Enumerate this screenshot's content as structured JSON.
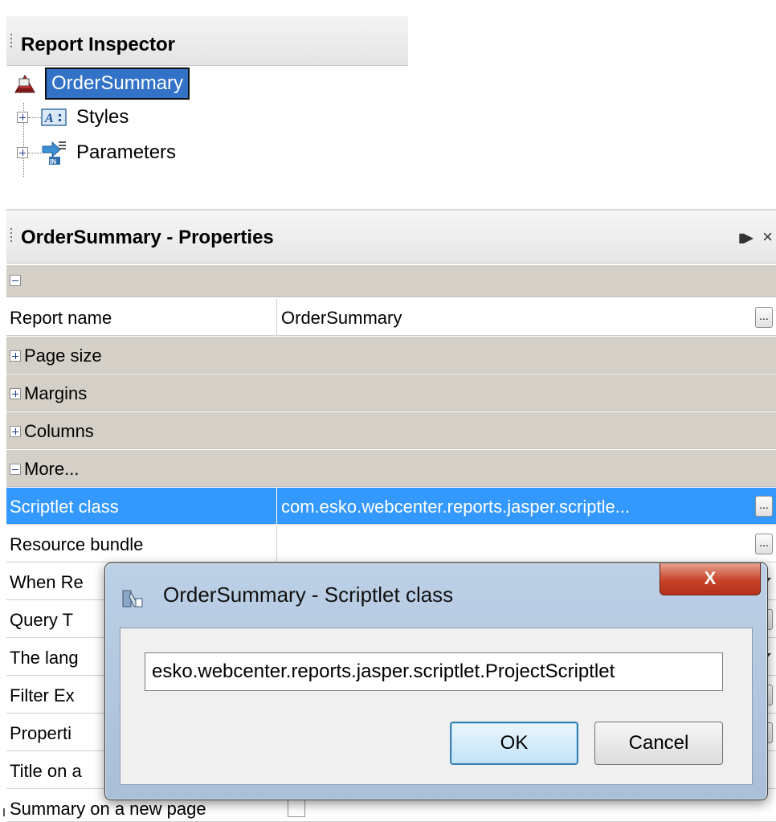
{
  "inspector": {
    "title": "Report Inspector",
    "root": {
      "label": "OrderSummary",
      "icon": "report-icon"
    },
    "nodes": [
      {
        "label": "Styles",
        "icon": "styles-icon"
      },
      {
        "label": "Parameters",
        "icon": "parameters-icon"
      }
    ]
  },
  "properties": {
    "title": "OrderSummary - Properties",
    "rows": {
      "report_name": {
        "name": "Report name",
        "value": "OrderSummary"
      },
      "page_size": {
        "name": "Page size"
      },
      "margins": {
        "name": "Margins"
      },
      "columns": {
        "name": "Columns"
      },
      "more": {
        "name": "More..."
      },
      "scriptlet_class": {
        "name": "Scriptlet class",
        "value": "com.esko.webcenter.reports.jasper.scriptle..."
      },
      "resource_bundle": {
        "name": "Resource bundle",
        "value": ""
      },
      "when_resource": {
        "name": "When Re"
      },
      "query_text": {
        "name": "Query T"
      },
      "language": {
        "name": "The lang"
      },
      "filter_expression": {
        "name": "Filter Ex"
      },
      "properties": {
        "name": "Properti"
      },
      "title_on": {
        "name": "Title on a"
      },
      "summary_new_page": {
        "name": "Summary on a new page"
      }
    },
    "ellipsis_label": "..."
  },
  "dialog": {
    "title": "OrderSummary - Scriptlet class",
    "close_label": "X",
    "input_value": "esko.webcenter.reports.jasper.scriptlet.ProjectScriptlet",
    "ok_label": "OK",
    "cancel_label": "Cancel"
  },
  "colors": {
    "selection": "#3399ff",
    "section_bg": "#d4d0c8",
    "inspector_selection": "#3272c7",
    "dialog_frame": "#b4c9e2",
    "close_button": "#c7432a"
  }
}
